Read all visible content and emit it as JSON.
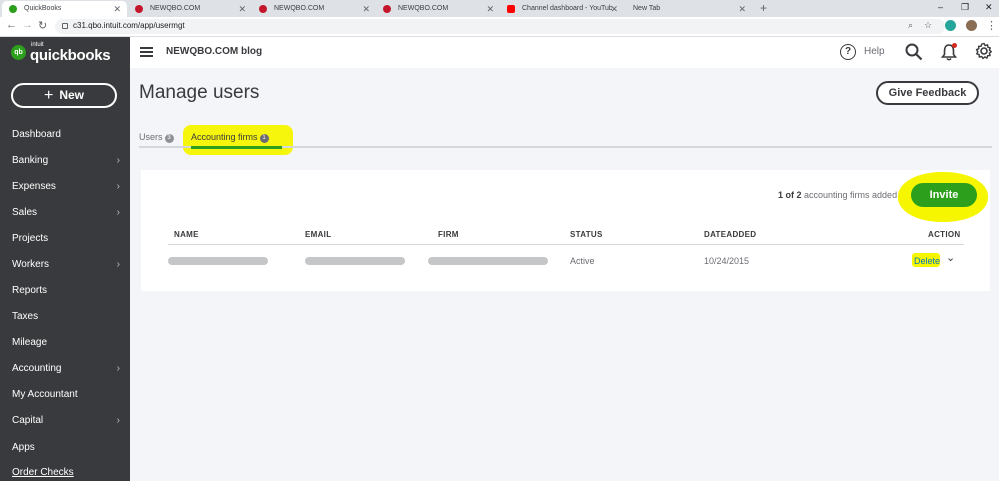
{
  "browser": {
    "tabs": [
      {
        "label": "QuickBooks",
        "favicon_color": "#2ca01c",
        "active": true
      },
      {
        "label": "NEWQBO.COM",
        "favicon_color": "#c4172c",
        "active": false
      },
      {
        "label": "NEWQBO.COM",
        "favicon_color": "#c4172c",
        "active": false
      },
      {
        "label": "NEWQBO.COM",
        "favicon_color": "#c4172c",
        "active": false
      },
      {
        "label": "Channel dashboard - YouTube St",
        "favicon_color": "#ff0000",
        "active": false
      },
      {
        "label": "New Tab",
        "favicon_color": "",
        "active": false
      }
    ],
    "url": "c31.qbo.intuit.com/app/usermgt"
  },
  "sidebar": {
    "logo_small": "intuit",
    "logo_text": "quickbooks",
    "logo_badge": "qb",
    "new_button": "New",
    "items": [
      {
        "label": "Dashboard",
        "has_chevron": false
      },
      {
        "label": "Banking",
        "has_chevron": true
      },
      {
        "label": "Expenses",
        "has_chevron": true
      },
      {
        "label": "Sales",
        "has_chevron": true
      },
      {
        "label": "Projects",
        "has_chevron": false
      },
      {
        "label": "Workers",
        "has_chevron": true
      },
      {
        "label": "Reports",
        "has_chevron": false
      },
      {
        "label": "Taxes",
        "has_chevron": false
      },
      {
        "label": "Mileage",
        "has_chevron": false
      },
      {
        "label": "Accounting",
        "has_chevron": true
      },
      {
        "label": "My Accountant",
        "has_chevron": false
      },
      {
        "label": "Capital",
        "has_chevron": true
      },
      {
        "label": "Apps",
        "has_chevron": false
      },
      {
        "label": "Order Checks",
        "has_chevron": false
      }
    ]
  },
  "header": {
    "company": "NEWQBO.COM blog",
    "help_label": "Help",
    "help_glyph": "?"
  },
  "main": {
    "title": "Manage users",
    "feedback_button": "Give Feedback",
    "tabs": [
      {
        "label": "Users",
        "count": "3"
      },
      {
        "label": "Accounting firms",
        "count": "1"
      }
    ],
    "count_bold": "1 of 2",
    "count_rest": " accounting firms added",
    "invite_button": "Invite",
    "table": {
      "columns": [
        "NAME",
        "EMAIL",
        "FIRM",
        "STATUS",
        "DATEADDED",
        "ACTION"
      ],
      "rows": [
        {
          "status": "Active",
          "date_added": "10/24/2015",
          "action": "Delete"
        }
      ]
    }
  },
  "colors": {
    "brand_green": "#2ca01c",
    "sidebar_bg": "#393a3d",
    "highlighter": "#f6f600",
    "link_blue": "#0077c5"
  }
}
